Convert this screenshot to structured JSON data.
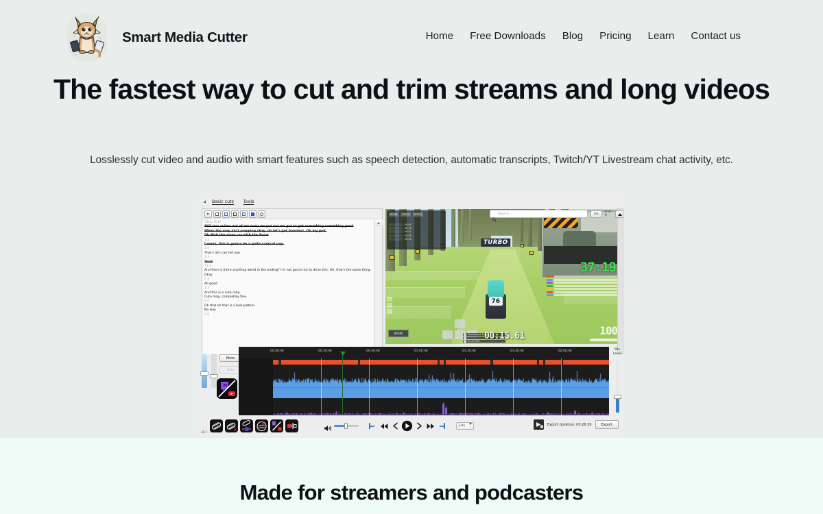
{
  "brand": {
    "name": "Smart Media Cutter",
    "logo_icon": "lynx-mascot-icon"
  },
  "nav": {
    "items": [
      {
        "label": "Home"
      },
      {
        "label": "Free Downloads"
      },
      {
        "label": "Blog"
      },
      {
        "label": "Pricing"
      },
      {
        "label": "Learn"
      },
      {
        "label": "Contact us"
      }
    ]
  },
  "hero": {
    "title": "The fastest way to cut and trim streams and long videos",
    "subtitle": "Losslessly cut video and audio with smart features such as speech detection, automatic transcripts, Twitch/YT Livestream chat activity, etc."
  },
  "section_two": {
    "title": "Made for streamers and podcasters"
  },
  "colors": {
    "hero_background": "#e9edeb",
    "section_two_background": "#eefbf6",
    "text_dark": "#0d1014",
    "clip_bar_red": "#e4512c",
    "waveform_blue": "#5a9fe6",
    "chat_purple": "#8b5fd6",
    "timer_green": "#37e84b",
    "playhead_green": "#2f8c2f",
    "slider_blue": "#4a90d9"
  },
  "app": {
    "menubar": {
      "grip_icon": "drag-grip-icon",
      "items": [
        {
          "label": "Basic cuts"
        },
        {
          "label": "Tools"
        }
      ]
    },
    "transcript_toolbar": {
      "buttons": [
        {
          "icon": "play-green-icon"
        },
        {
          "icon": "copy-icon"
        },
        {
          "icon": "paste-icon"
        },
        {
          "icon": "save-disk-icon"
        },
        {
          "icon": "duplicate-icon"
        },
        {
          "icon": "stop-square-icon"
        },
        {
          "icon": "refresh-circle-icon"
        }
      ]
    },
    "search": {
      "icon": "search-icon",
      "placeholder": "Search...",
      "value": "",
      "go_label": "Go",
      "match_count": "0 of 0",
      "prev_icon": "arrow-up-icon",
      "next_icon": "arrow-down-icon"
    },
    "transcript": {
      "lines": [
        {
          "text": "Okay. 8:32",
          "style": "ts"
        },
        {
          "text": "Still two suites out of me even we got out we got to get something something good",
          "style": "cut"
        },
        {
          "text": "When the map ain't mapping okay, oh let's get boosters. Oh my god.",
          "style": "cut"
        },
        {
          "text": "Oh Woh the snow car with the Snow",
          "style": "cut"
        },
        {
          "text": "3.2",
          "style": "ts"
        },
        {
          "text": "I mean, this is gonna be a quite comical nap.",
          "style": "cut"
        },
        {
          "text": "3.6",
          "style": "ts"
        },
        {
          "text": "That's all I can tell you",
          "style": "normal"
        },
        {
          "text": "3.3",
          "style": "ts"
        },
        {
          "text": "Yeah",
          "style": "cut"
        },
        {
          "text": "11.3",
          "style": "ts"
        },
        {
          "text": "And then is there anything weird in the ending? I'm not gonna try to drive this. Oh, that's the same thing. Okay.",
          "style": "wrap"
        },
        {
          "text": "2.2",
          "style": "ts"
        },
        {
          "text": "All good",
          "style": "normal"
        },
        {
          "text": "1.5",
          "style": "ts"
        },
        {
          "text": "And this is a cute map.",
          "style": "normal"
        },
        {
          "text": "Cute map, completely fine.",
          "style": "normal"
        },
        {
          "text": "8.0",
          "style": "ts"
        },
        {
          "text": "Oh that oh that is a bad pattern",
          "style": "normal"
        },
        {
          "text": "No way",
          "style": "normal"
        },
        {
          "text": "3.0",
          "style": "ts"
        }
      ]
    },
    "video_preview": {
      "turbo_label": "TURBO",
      "car_number": "76",
      "stream_timer": "37:19",
      "lap_timer": "00:15.61",
      "speed": "100",
      "brake_label": "BRAKE",
      "hud_chips": [
        "00:00",
        "37/19",
        "0:17.3"
      ],
      "checkpoint_rows": [
        "Checkpoint 4/9",
        "00:03.008"
      ],
      "hud_entries": [
        {
          "name": "",
          "time": "00:09"
        },
        {
          "name": "",
          "time": "00:14"
        },
        {
          "name": "",
          "time": "00:21"
        },
        {
          "name": "",
          "time": "00:26"
        },
        {
          "name": "",
          "time": "00:33"
        }
      ]
    },
    "timeline": {
      "mute_label": "Mute",
      "solo_label": "Solo",
      "platform_icon": "twitch-youtube-icon",
      "mix_level_label": "Mix Level",
      "ticks": [
        "00:00:00",
        "00:20:00",
        "00:40:00",
        "01:00:00",
        "01:20:00",
        "01:40:00",
        "02:00:00"
      ]
    },
    "bottom_bar": {
      "version": "v0.7",
      "tool_icons": [
        {
          "icon": "cut-region-icon"
        },
        {
          "icon": "delete-region-icon"
        },
        {
          "icon": "merge-region-icon"
        },
        {
          "icon": "remove-silence-icon"
        },
        {
          "icon": "split-marker-icon"
        },
        {
          "icon": "crop-frame-icon"
        }
      ],
      "volume_icon": "speaker-icon",
      "transport": [
        {
          "icon": "mark-in-icon"
        },
        {
          "icon": "skip-back-icon"
        },
        {
          "icon": "step-back-icon"
        },
        {
          "icon": "play-icon"
        },
        {
          "icon": "step-forward-icon"
        },
        {
          "icon": "skip-forward-icon"
        },
        {
          "icon": "mark-out-icon"
        }
      ],
      "speed_value": "1.0x",
      "export_icon": "export-video-icon",
      "export_duration_label": "Export duration: 00:26:30",
      "export_button_label": "Export"
    }
  }
}
